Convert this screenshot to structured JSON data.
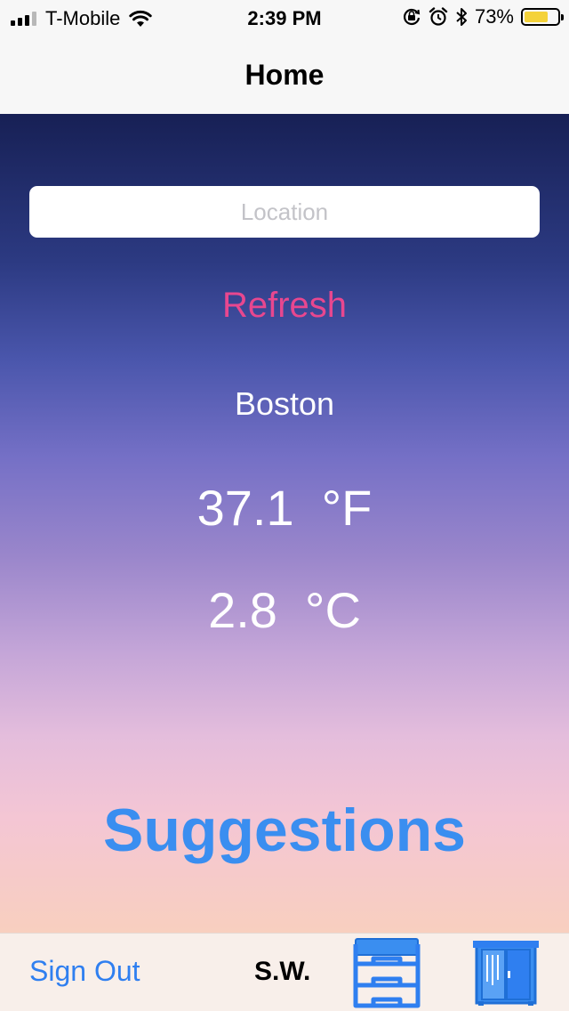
{
  "status_bar": {
    "carrier": "T-Mobile",
    "time": "2:39 PM",
    "battery_percent": "73%",
    "battery_level": 0.73,
    "icons": [
      "signal-icon",
      "wifi-icon",
      "orientation-lock-icon",
      "alarm-icon",
      "bluetooth-icon",
      "battery-icon"
    ]
  },
  "nav": {
    "title": "Home"
  },
  "main": {
    "location_placeholder": "Location",
    "location_value": "",
    "refresh_label": "Refresh",
    "city": "Boston",
    "temp_f": "37.1  °F",
    "temp_c": "2.8  °C",
    "suggestions_label": "Suggestions"
  },
  "tab_bar": {
    "sign_out_label": "Sign Out",
    "initials": "S.W.",
    "icons": [
      "inbox-tray-icon",
      "wardrobe-icon"
    ]
  },
  "colors": {
    "accent_blue": "#3a8ef0",
    "refresh_pink": "#e8478f",
    "battery_yellow": "#f4d23a",
    "gradient_top": "#172055",
    "gradient_bottom": "#f8cfbf"
  }
}
